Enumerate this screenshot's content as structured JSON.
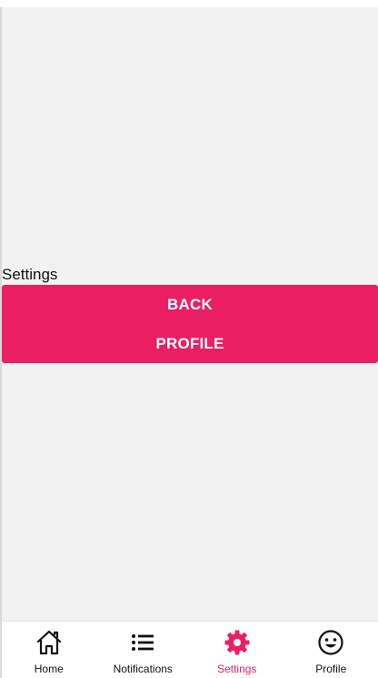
{
  "screen": {
    "title": "Settings"
  },
  "buttons": {
    "back_label": "BACK",
    "profile_label": "PROFILE"
  },
  "tabbar": {
    "active": "Settings",
    "items": [
      {
        "label": "Home",
        "icon": "home-icon"
      },
      {
        "label": "Notifications",
        "icon": "list-icon"
      },
      {
        "label": "Settings",
        "icon": "gear-icon"
      },
      {
        "label": "Profile",
        "icon": "smiley-icon"
      }
    ]
  },
  "colors": {
    "accent": "#ea1f63",
    "background": "#f2f2f2",
    "text": "#111111"
  }
}
